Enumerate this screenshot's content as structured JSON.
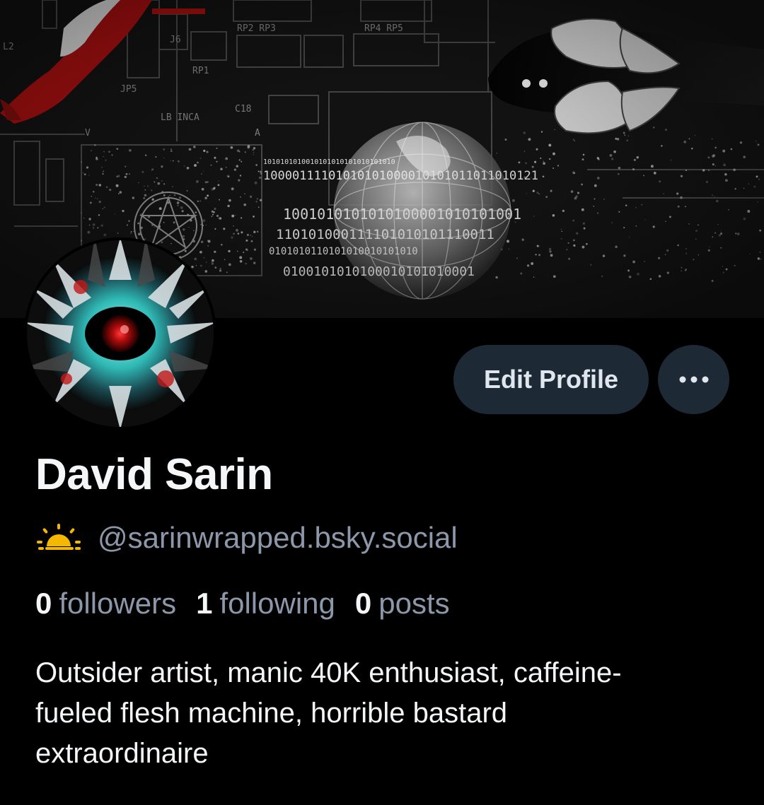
{
  "profile": {
    "display_name": "David Sarin",
    "handle": "@sarinwrapped.bsky.social",
    "handle_emoji": "sun-behind-cloud-icon",
    "bio": "Outsider artist, manic 40K enthusiast, caffeine-fueled flesh machine, horrible bastard extraordinaire"
  },
  "stats": {
    "followers_count": "0",
    "followers_label": "followers",
    "following_count": "1",
    "following_label": "following",
    "posts_count": "0",
    "posts_label": "posts"
  },
  "actions": {
    "edit_profile_label": "Edit Profile",
    "more_icon": "ellipsis-icon"
  },
  "banner": {
    "board_labels": [
      "RP2 RP3",
      "RP4 RP5",
      "RP1",
      "JP5",
      "J6",
      "C18",
      "LB INCA",
      "V",
      "A",
      "L2"
    ],
    "binary_lines": [
      "1010101010010101010101010101010",
      "10000111101010101000010101011011010121",
      "1001010101010100001010101001",
      "110101000111101010101110011",
      "0101010110101010010101010",
      "0100101010100010101010001"
    ]
  },
  "colors": {
    "background": "#000000",
    "button_bg": "#1e2936",
    "muted_text": "#8c98aa",
    "primary_text": "#f4f6f8"
  }
}
